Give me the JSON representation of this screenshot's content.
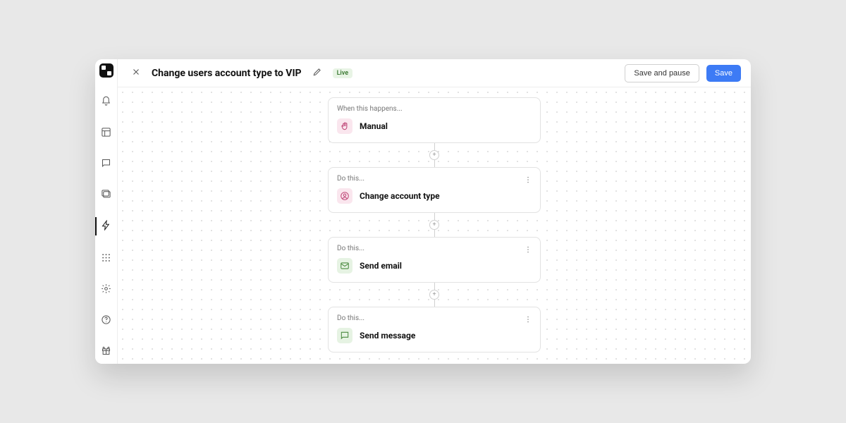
{
  "header": {
    "title": "Change users account type to VIP",
    "status_badge": "Live",
    "save_pause_label": "Save and pause",
    "save_label": "Save"
  },
  "sidebar": {
    "items": [
      {
        "name": "notifications",
        "icon": "bell",
        "active": false
      },
      {
        "name": "layouts",
        "icon": "layout",
        "active": false
      },
      {
        "name": "messages",
        "icon": "message",
        "active": false
      },
      {
        "name": "images",
        "icon": "images",
        "active": false
      },
      {
        "name": "automations",
        "icon": "bolt",
        "active": true
      }
    ],
    "footer": [
      {
        "name": "apps",
        "icon": "grid"
      },
      {
        "name": "settings",
        "icon": "gear"
      },
      {
        "name": "help",
        "icon": "help"
      },
      {
        "name": "gift",
        "icon": "gift"
      }
    ]
  },
  "flow": {
    "trigger": {
      "label": "When this happens...",
      "title": "Manual",
      "icon": "hand",
      "icon_color": "pink",
      "has_menu": false
    },
    "steps": [
      {
        "label": "Do this...",
        "title": "Change account type",
        "icon": "user-circle",
        "icon_color": "pink",
        "has_menu": true
      },
      {
        "label": "Do this...",
        "title": "Send email",
        "icon": "mail",
        "icon_color": "green",
        "has_menu": true
      },
      {
        "label": "Do this...",
        "title": "Send message",
        "icon": "message",
        "icon_color": "green",
        "has_menu": true
      }
    ]
  }
}
